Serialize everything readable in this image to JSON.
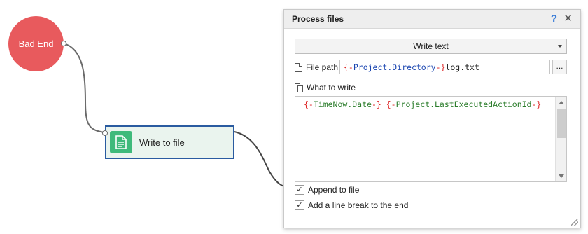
{
  "canvas": {
    "bad_end_label": "Bad End",
    "node_label": "Write to file"
  },
  "panel": {
    "title": "Process files",
    "help_label": "?",
    "close_label": "✕",
    "action_select": "Write text",
    "file_path_label": "File path",
    "file_path_value": {
      "part1": "{-Project.Directory-}",
      "part2": "log.txt"
    },
    "browse_label": "...",
    "what_to_write_label": "What to write",
    "content": {
      "token1": "{-TimeNow.Date-}",
      "token2": "{-Project.LastExecutedActionId-}"
    },
    "append_label": "Append to file",
    "append_checked": true,
    "linebreak_label": "Add a line break to the end",
    "linebreak_checked": true,
    "check_mark": "✓"
  },
  "colors": {
    "bad_end": "#e85a5d",
    "node_border": "#2a5ba0",
    "node_icon": "#3fba7b",
    "help": "#3b7dd8"
  }
}
